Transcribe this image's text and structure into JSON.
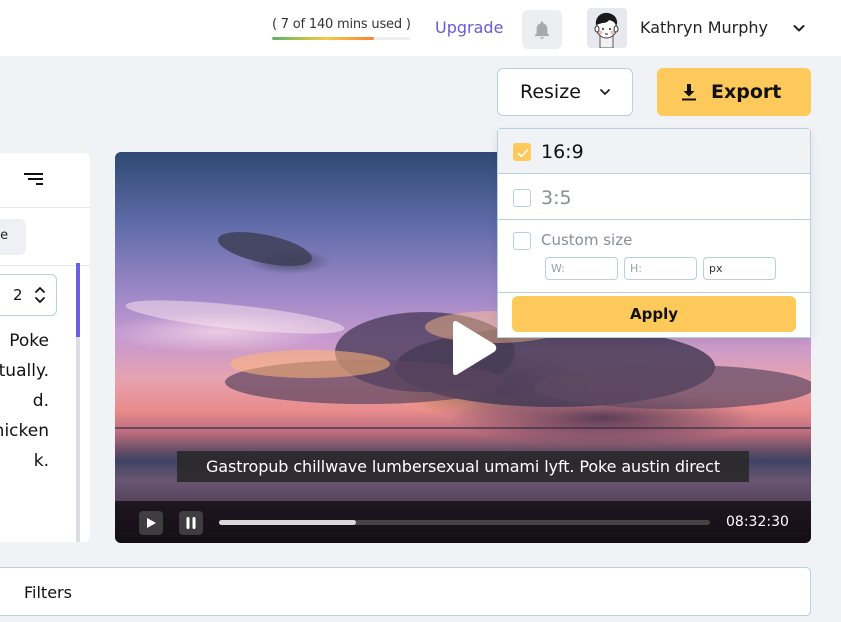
{
  "header": {
    "usage_text": "( 7 of 140 mins used )",
    "usage_fraction": 0.05,
    "usage_bar_fill_fraction": 0.74,
    "upgrade_label": "Upgrade",
    "notification_icon": "bell-icon",
    "user": {
      "name": "Kathryn Murphy",
      "avatar_icon": "avatar-illustration",
      "menu_icon": "chevron-down-icon"
    }
  },
  "toolbar": {
    "resize_label": "Resize",
    "resize_icon": "chevron-down-icon",
    "export_label": "Export",
    "export_icon": "download-icon"
  },
  "resize_menu": {
    "options": [
      {
        "label": "16:9",
        "checked": true
      },
      {
        "label": "3:5",
        "checked": false
      },
      {
        "label": "Custom size",
        "checked": false
      }
    ],
    "custom": {
      "width_placeholder": "W:",
      "height_placeholder": "H:",
      "unit_value": "px"
    },
    "apply_label": "Apply"
  },
  "left_panel": {
    "filter_icon": "filter-lines-icon",
    "chip_label": "te",
    "stepper_value": "2",
    "text_lines": [
      "Poke",
      "ctually.",
      "d.",
      "hicken",
      "k."
    ]
  },
  "video": {
    "caption": "Gastropub chillwave lumbersexual umami lyft. Poke austin direct",
    "time": "08:32:30",
    "progress_fraction": 0.28,
    "play_icon": "play-icon",
    "pause_icon": "pause-icon"
  },
  "filters": {
    "label": "Filters"
  },
  "colors": {
    "accent": "#6a5bd6",
    "primary_button": "#fdc95b",
    "border": "#b8d0de",
    "background": "#f0f2f6"
  }
}
